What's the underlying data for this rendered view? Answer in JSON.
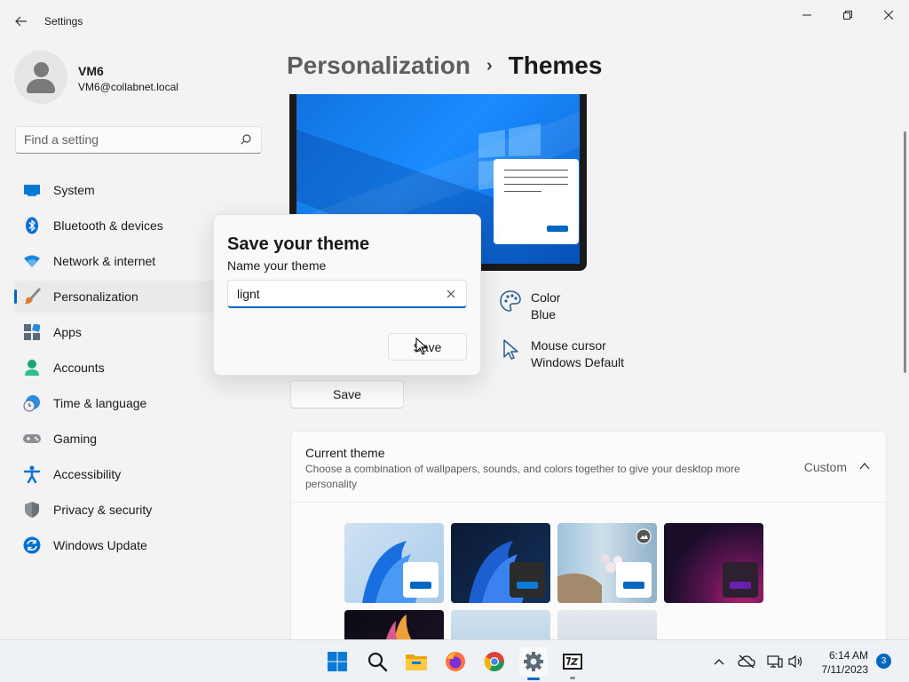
{
  "window": {
    "app_title": "Settings",
    "back_icon": "back-arrow-icon",
    "controls": [
      "minimize-icon",
      "maximize-icon",
      "close-icon"
    ]
  },
  "profile": {
    "name": "VM6",
    "email": "VM6@collabnet.local"
  },
  "search": {
    "placeholder": "Find a setting"
  },
  "sidebar": {
    "items": [
      {
        "label": "System",
        "icon": "system-icon",
        "active": false
      },
      {
        "label": "Bluetooth & devices",
        "icon": "bluetooth-icon",
        "active": false
      },
      {
        "label": "Network & internet",
        "icon": "wifi-icon",
        "active": false
      },
      {
        "label": "Personalization",
        "icon": "brush-icon",
        "active": true
      },
      {
        "label": "Apps",
        "icon": "apps-icon",
        "active": false
      },
      {
        "label": "Accounts",
        "icon": "accounts-icon",
        "active": false
      },
      {
        "label": "Time & language",
        "icon": "clock-globe-icon",
        "active": false
      },
      {
        "label": "Gaming",
        "icon": "gamepad-icon",
        "active": false
      },
      {
        "label": "Accessibility",
        "icon": "accessibility-icon",
        "active": false
      },
      {
        "label": "Privacy & security",
        "icon": "shield-icon",
        "active": false
      },
      {
        "label": "Windows Update",
        "icon": "update-icon",
        "active": false
      }
    ]
  },
  "breadcrumb": {
    "parent": "Personalization",
    "separator": "›",
    "current": "Themes"
  },
  "theme_props": {
    "color_title": "Color",
    "color_value": "Blue",
    "cursor_title": "Mouse cursor",
    "cursor_value": "Windows Default"
  },
  "main": {
    "save_label": "Save"
  },
  "current_theme": {
    "title": "Current theme",
    "description": "Choose a combination of wallpapers, sounds, and colors together to give your desktop more personality",
    "value": "Custom",
    "themes": [
      "windows-light-theme",
      "windows-dark-theme",
      "flowers-theme",
      "glow-theme",
      "captured-motion-theme",
      "sunrise-theme",
      "flow-theme"
    ]
  },
  "dialog": {
    "title": "Save your theme",
    "label": "Name your theme",
    "input_value": "lignt",
    "save_label": "Save"
  },
  "taskbar": {
    "apps": [
      "start-icon",
      "search-icon",
      "file-explorer-icon",
      "firefox-icon",
      "chrome-icon",
      "settings-icon",
      "7zip-icon"
    ],
    "time": "6:14 AM",
    "date": "7/11/2023",
    "notification_count": "3"
  },
  "colors": {
    "accent": "#0067c0",
    "background": "#f3f3f3",
    "taskbar": "#eef1f6"
  }
}
